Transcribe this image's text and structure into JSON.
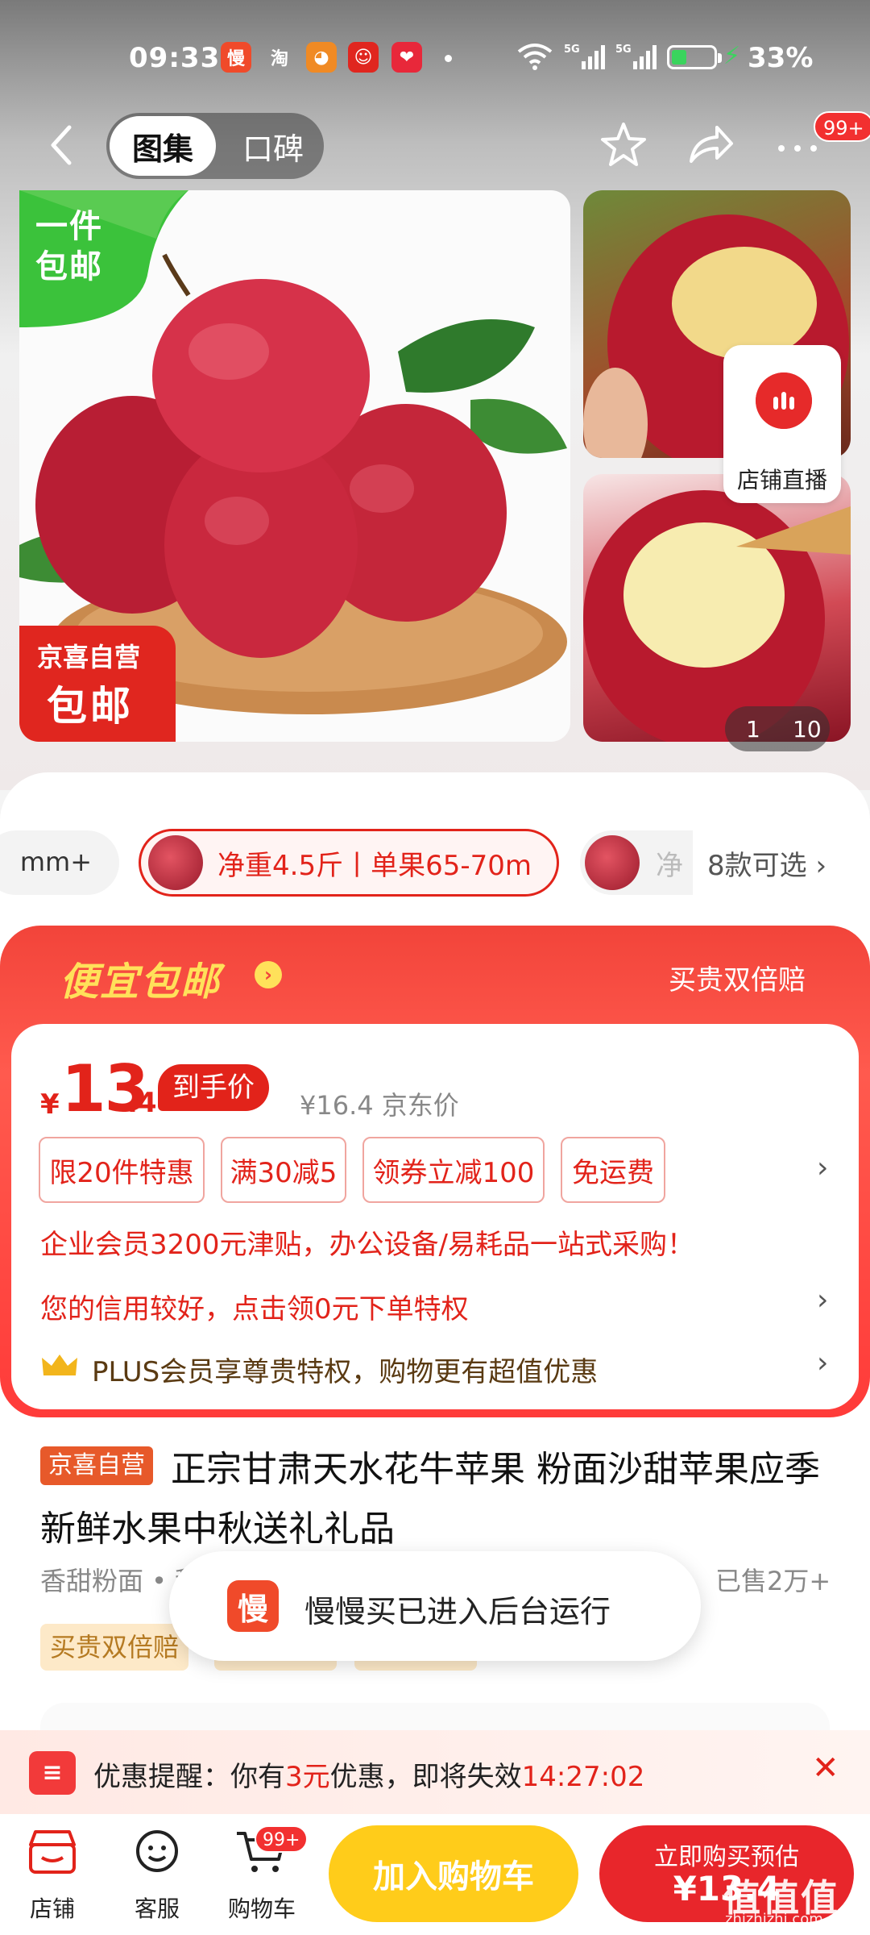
{
  "status_bar": {
    "time": "09:33",
    "app_icons": [
      {
        "name": "manman-app-icon",
        "glyph": "慢",
        "color": "#f04a2a"
      },
      {
        "name": "taobao-app-icon",
        "glyph": "淘",
        "color": "#ff6a00"
      },
      {
        "name": "orange-app-icon",
        "glyph": "◕",
        "color": "#f08a24"
      },
      {
        "name": "mascot-app-icon",
        "glyph": "☺",
        "color": "#e0261f"
      },
      {
        "name": "heart-app-icon",
        "glyph": "❤",
        "color": "#e8283a"
      }
    ],
    "network": "5G",
    "battery_percent": "33%"
  },
  "nav": {
    "tab_gallery": "图集",
    "tab_reviews": "口碑",
    "more_badge": "99+"
  },
  "gallery": {
    "main_corner_label": "一件\n包邮",
    "jx_badge_line1": "京喜自营",
    "jx_badge_line2": "包邮",
    "live_label": "店铺直播",
    "pager_current": "1",
    "pager_total": "10"
  },
  "specs": {
    "prev_partial": "mm+",
    "selected": "净重4.5斤丨单果65-70m",
    "next_partial": "净",
    "more": "8款可选 ›"
  },
  "promo": {
    "title": "便宜包邮",
    "right_label": "买贵双倍赔",
    "currency": "¥",
    "price_int": "13",
    "price_dec": ".4",
    "price_tag": "到手价",
    "jd_price": "¥16.4 京东价",
    "chips": [
      "限20件特惠",
      "满30减5",
      "领券立减100",
      "免运费"
    ],
    "enterprise_line": "企业会员3200元津贴，办公设备/易耗品一站式采购！",
    "credit_line": "您的信用较好，点击领0元下单特权",
    "plus_line": "PLUS会员享尊贵特权，购物更有超值优惠"
  },
  "product": {
    "tag": "京喜自营",
    "title": "正宗甘肃天水花牛苹果 粉面沙甜苹果应季新鲜水果中秋送礼礼品",
    "tags_line": "香甜粉面 • 甜爽多汁 • 果肉细腻",
    "sold": "已售2万+",
    "yellow_tags": [
      "买贵双倍赔",
      "坏损包退",
      "足斤足两"
    ]
  },
  "toast": {
    "icon_glyph": "慢",
    "text": "慢慢买已进入后台运行"
  },
  "reminder": {
    "icon_glyph": "≡",
    "prefix": "优惠提醒：你有",
    "amount": "3元",
    "middle": "优惠，即将失效",
    "countdown": "14:27:02"
  },
  "bottom_bar": {
    "shop": "店铺",
    "service": "客服",
    "cart": "购物车",
    "cart_badge": "99+",
    "add_to_cart": "加入购物车",
    "buy_now_line1": "立即购买预估",
    "buy_now_line2": "¥13.4"
  },
  "watermark": {
    "text": "值值值",
    "sub": "zhizhizhi.com"
  },
  "colors": {
    "brand_red": "#e2231a",
    "yellow_button": "#ffcc1a",
    "promo_yellow": "#ffe15a"
  }
}
